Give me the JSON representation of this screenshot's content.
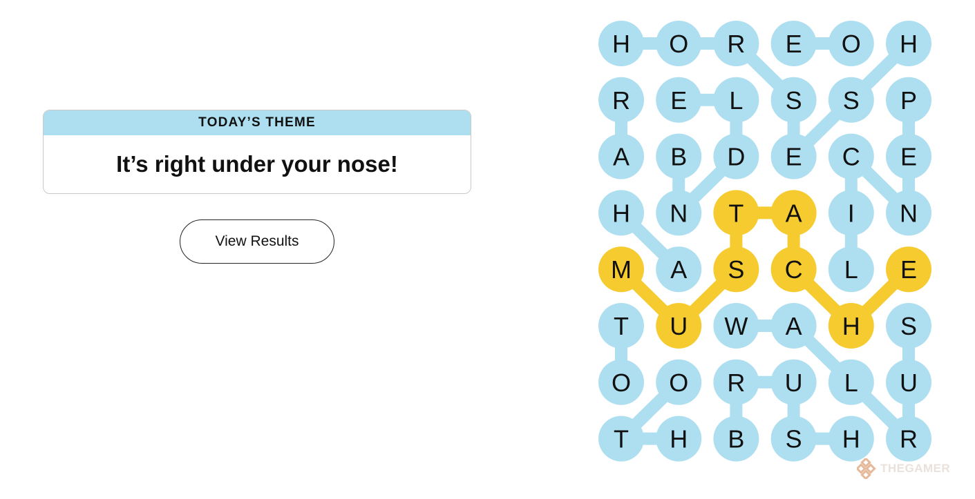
{
  "theme": {
    "header": "TODAY’S THEME",
    "text": "It’s right under your nose!"
  },
  "actions": {
    "view_results": "View Results"
  },
  "board": {
    "rows": [
      [
        "H",
        "O",
        "R",
        "E",
        "O",
        "H"
      ],
      [
        "R",
        "E",
        "L",
        "S",
        "S",
        "P"
      ],
      [
        "A",
        "B",
        "D",
        "E",
        "C",
        "E"
      ],
      [
        "H",
        "N",
        "T",
        "A",
        "I",
        "N"
      ],
      [
        "M",
        "A",
        "S",
        "C",
        "L",
        "E"
      ],
      [
        "T",
        "U",
        "W",
        "A",
        "H",
        "S"
      ],
      [
        "O",
        "O",
        "R",
        "U",
        "L",
        "U"
      ],
      [
        "T",
        "H",
        "B",
        "S",
        "H",
        "R"
      ]
    ],
    "highlighted": [
      [
        3,
        2
      ],
      [
        3,
        3
      ],
      [
        4,
        0
      ],
      [
        4,
        2
      ],
      [
        4,
        3
      ],
      [
        4,
        5
      ],
      [
        5,
        1
      ],
      [
        5,
        4
      ]
    ],
    "links": [
      {
        "color": "blue",
        "cells": [
          [
            0,
            0
          ],
          [
            0,
            1
          ],
          [
            0,
            2
          ],
          [
            1,
            3
          ],
          [
            2,
            3
          ],
          [
            1,
            4
          ],
          [
            0,
            5
          ]
        ]
      },
      {
        "color": "blue",
        "cells": [
          [
            0,
            3
          ],
          [
            0,
            4
          ]
        ]
      },
      {
        "color": "blue",
        "cells": [
          [
            1,
            0
          ],
          [
            2,
            0
          ]
        ]
      },
      {
        "color": "blue",
        "cells": [
          [
            1,
            1
          ],
          [
            1,
            2
          ],
          [
            2,
            2
          ],
          [
            3,
            1
          ],
          [
            2,
            1
          ]
        ]
      },
      {
        "color": "blue",
        "cells": [
          [
            1,
            5
          ],
          [
            2,
            5
          ],
          [
            3,
            5
          ]
        ]
      },
      {
        "color": "blue",
        "cells": [
          [
            2,
            4
          ],
          [
            3,
            4
          ],
          [
            4,
            4
          ]
        ]
      },
      {
        "color": "blue",
        "cells": [
          [
            2,
            4
          ],
          [
            3,
            5
          ]
        ]
      },
      {
        "color": "blue",
        "cells": [
          [
            3,
            0
          ],
          [
            4,
            1
          ]
        ]
      },
      {
        "color": "blue",
        "cells": [
          [
            5,
            0
          ],
          [
            6,
            0
          ]
        ]
      },
      {
        "color": "blue",
        "cells": [
          [
            6,
            1
          ],
          [
            7,
            0
          ]
        ]
      },
      {
        "color": "blue",
        "cells": [
          [
            7,
            0
          ],
          [
            7,
            1
          ]
        ]
      },
      {
        "color": "blue",
        "cells": [
          [
            5,
            2
          ],
          [
            5,
            3
          ],
          [
            6,
            4
          ],
          [
            7,
            5
          ],
          [
            6,
            5
          ],
          [
            5,
            5
          ]
        ]
      },
      {
        "color": "blue",
        "cells": [
          [
            6,
            2
          ],
          [
            6,
            3
          ],
          [
            7,
            3
          ],
          [
            7,
            4
          ]
        ]
      },
      {
        "color": "blue",
        "cells": [
          [
            6,
            2
          ],
          [
            7,
            2
          ]
        ]
      },
      {
        "color": "yellow",
        "cells": [
          [
            4,
            0
          ],
          [
            5,
            1
          ],
          [
            4,
            2
          ],
          [
            3,
            2
          ],
          [
            3,
            3
          ],
          [
            4,
            3
          ],
          [
            5,
            4
          ],
          [
            4,
            5
          ]
        ]
      }
    ]
  },
  "colors": {
    "cell": "#aedff0",
    "highlight": "#f6cb2f",
    "text": "#111111"
  },
  "watermark": {
    "text": "THEGAMER",
    "icon": "thegamer-logo-icon"
  }
}
